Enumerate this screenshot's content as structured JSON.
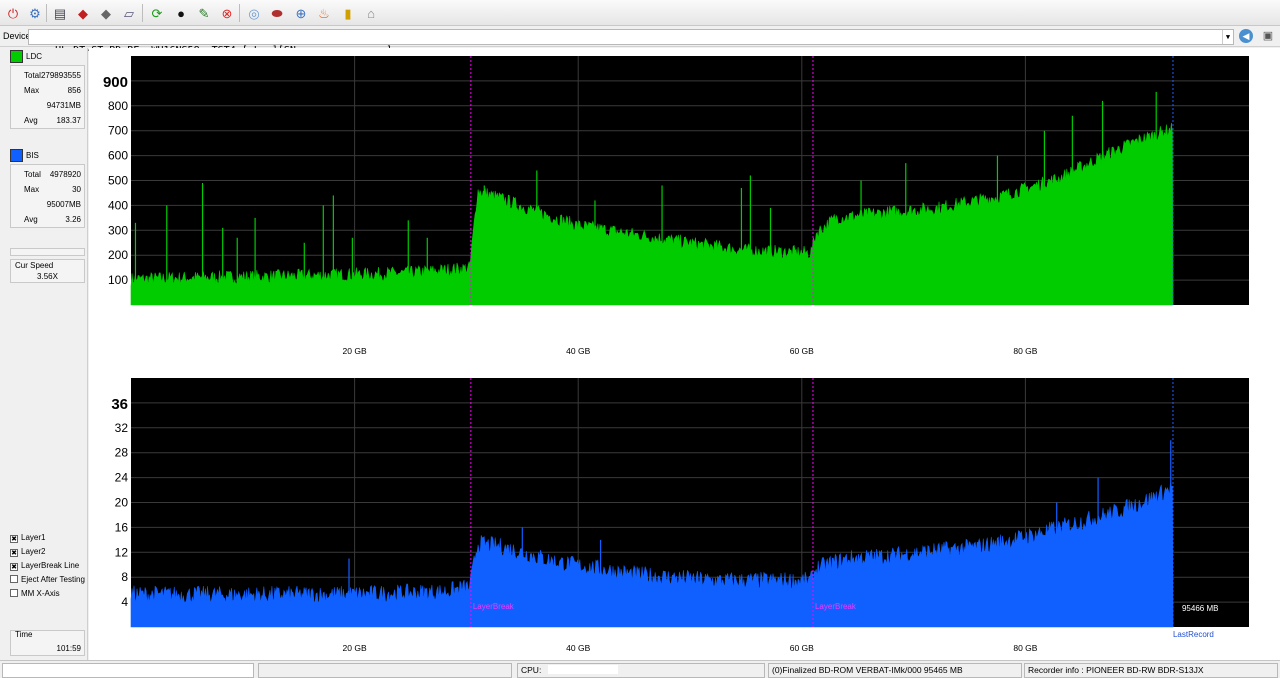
{
  "toolbar": {
    "icons": [
      "power-icon",
      "disc-info-icon",
      "drive-icon",
      "eject-red-icon",
      "disc-gray-icon",
      "write-icon",
      "refresh-icon",
      "disc-play-icon",
      "settings-icon",
      "stop-icon",
      "blank-disc-icon",
      "burn-icon",
      "copy-icon",
      "fire-icon",
      "bar-graph-icon",
      "erase-icon"
    ]
  },
  "device": {
    "label": "Device:",
    "value": "HL-DT-ST BD-RE  WH16NS58  TST4 [ L: ][SN:              ]"
  },
  "ldc": {
    "title": "LDC",
    "color": "#00cc00",
    "rows": [
      {
        "label": "Total",
        "value": "279893555"
      },
      {
        "label": "Max",
        "value": "856"
      },
      {
        "label": "",
        "value": "94731MB"
      },
      {
        "label": "Avg",
        "value": "183.37"
      }
    ]
  },
  "bis": {
    "title": "BIS",
    "color": "#1060ff",
    "rows": [
      {
        "label": "Total",
        "value": "4978920"
      },
      {
        "label": "Max",
        "value": "30"
      },
      {
        "label": "",
        "value": "95007MB"
      },
      {
        "label": "Avg",
        "value": "3.26"
      }
    ]
  },
  "speed": {
    "title": "Cur Speed",
    "value": "3.56X"
  },
  "options": [
    {
      "label": "Layer1",
      "checked": true
    },
    {
      "label": "Layer2",
      "checked": true
    },
    {
      "label": "LayerBreak Line",
      "checked": true
    },
    {
      "label": "Eject After Testing",
      "checked": false
    },
    {
      "label": "MM X-Axis",
      "checked": false
    }
  ],
  "time": {
    "title": "Time",
    "value": "101:59"
  },
  "status": {
    "p1": "",
    "p2": "",
    "cpu": "CPU:",
    "disc": "(0)Finalized   BD-ROM   VERBAT-IMk/000   95465 MB",
    "recorder": "Recorder info : PIONEER       BD-RW   BDR-S13JX"
  },
  "chart_data": [
    {
      "type": "area",
      "name": "LDC",
      "color": "#00cc00",
      "x_unit": "GB",
      "xlim": [
        0,
        100
      ],
      "ylim": [
        0,
        1000
      ],
      "y_ticks": [
        100,
        200,
        300,
        400,
        500,
        600,
        700,
        800
      ],
      "y_top_label": "900",
      "x_ticks": [
        "20 GB",
        "40 GB",
        "60 GB",
        "80 GB"
      ],
      "x_tick_values": [
        20,
        40,
        60,
        80
      ],
      "layer_breaks": [
        30.4,
        61
      ],
      "end_gb": 93.2,
      "profile": {
        "x": [
          0,
          5,
          15,
          25,
          30.3,
          31,
          33,
          36,
          40,
          45,
          50,
          55,
          60.8,
          61.3,
          63,
          67,
          72,
          78,
          83,
          87,
          90,
          93.2
        ],
        "y": [
          95,
          100,
          108,
          120,
          140,
          450,
          420,
          370,
          310,
          275,
          240,
          210,
          200,
          280,
          340,
          360,
          380,
          430,
          500,
          590,
          650,
          700
        ]
      },
      "spikes": [
        {
          "x": 0.4,
          "y": 330
        },
        {
          "x": 3.2,
          "y": 400
        },
        {
          "x": 6.4,
          "y": 490
        },
        {
          "x": 8.2,
          "y": 310
        },
        {
          "x": 9.5,
          "y": 270
        },
        {
          "x": 11.1,
          "y": 350
        },
        {
          "x": 15.5,
          "y": 250
        },
        {
          "x": 17.2,
          "y": 400
        },
        {
          "x": 18.1,
          "y": 440
        },
        {
          "x": 19.8,
          "y": 270
        },
        {
          "x": 24.8,
          "y": 340
        },
        {
          "x": 26.5,
          "y": 270
        },
        {
          "x": 31.6,
          "y": 480
        },
        {
          "x": 36.3,
          "y": 540
        },
        {
          "x": 41.5,
          "y": 420
        },
        {
          "x": 47.5,
          "y": 480
        },
        {
          "x": 54.6,
          "y": 470
        },
        {
          "x": 55.4,
          "y": 520
        },
        {
          "x": 57.2,
          "y": 390
        },
        {
          "x": 65.3,
          "y": 500
        },
        {
          "x": 69.3,
          "y": 570
        },
        {
          "x": 77.5,
          "y": 600
        },
        {
          "x": 81.7,
          "y": 700
        },
        {
          "x": 84.2,
          "y": 760
        },
        {
          "x": 86.9,
          "y": 820
        },
        {
          "x": 91.7,
          "y": 856
        }
      ],
      "noise": 35
    },
    {
      "type": "area",
      "name": "BIS",
      "color": "#1060ff",
      "x_unit": "GB",
      "xlim": [
        0,
        100
      ],
      "ylim": [
        0,
        40
      ],
      "y_ticks": [
        4,
        8,
        12,
        16,
        20,
        24,
        28,
        32
      ],
      "y_top_label": "36",
      "x_ticks": [
        "20 GB",
        "40 GB",
        "60 GB",
        "80 GB"
      ],
      "x_tick_values": [
        20,
        40,
        60,
        80
      ],
      "layer_breaks": [
        30.4,
        61
      ],
      "end_gb": 93.2,
      "layer_break_label": "LayerBreak",
      "end_value_label": "95466 MB",
      "last_record_label": "LastRecord",
      "profile": {
        "x": [
          0,
          10,
          20,
          28,
          30.3,
          31,
          33,
          38,
          45,
          52,
          60.8,
          61.3,
          64,
          68,
          72,
          76,
          80,
          84,
          88,
          91,
          93.2
        ],
        "y": [
          4.8,
          4.7,
          4.8,
          5.2,
          6,
          13,
          12.5,
          10,
          8,
          7,
          7,
          9,
          10.5,
          11,
          11.8,
          12.5,
          14,
          16,
          18,
          20,
          22
        ]
      },
      "spikes": [
        {
          "x": 19.5,
          "y": 11
        },
        {
          "x": 35,
          "y": 16
        },
        {
          "x": 42,
          "y": 14
        },
        {
          "x": 82.8,
          "y": 20
        },
        {
          "x": 86.5,
          "y": 24
        },
        {
          "x": 93,
          "y": 30
        }
      ],
      "noise": 1.8
    }
  ]
}
